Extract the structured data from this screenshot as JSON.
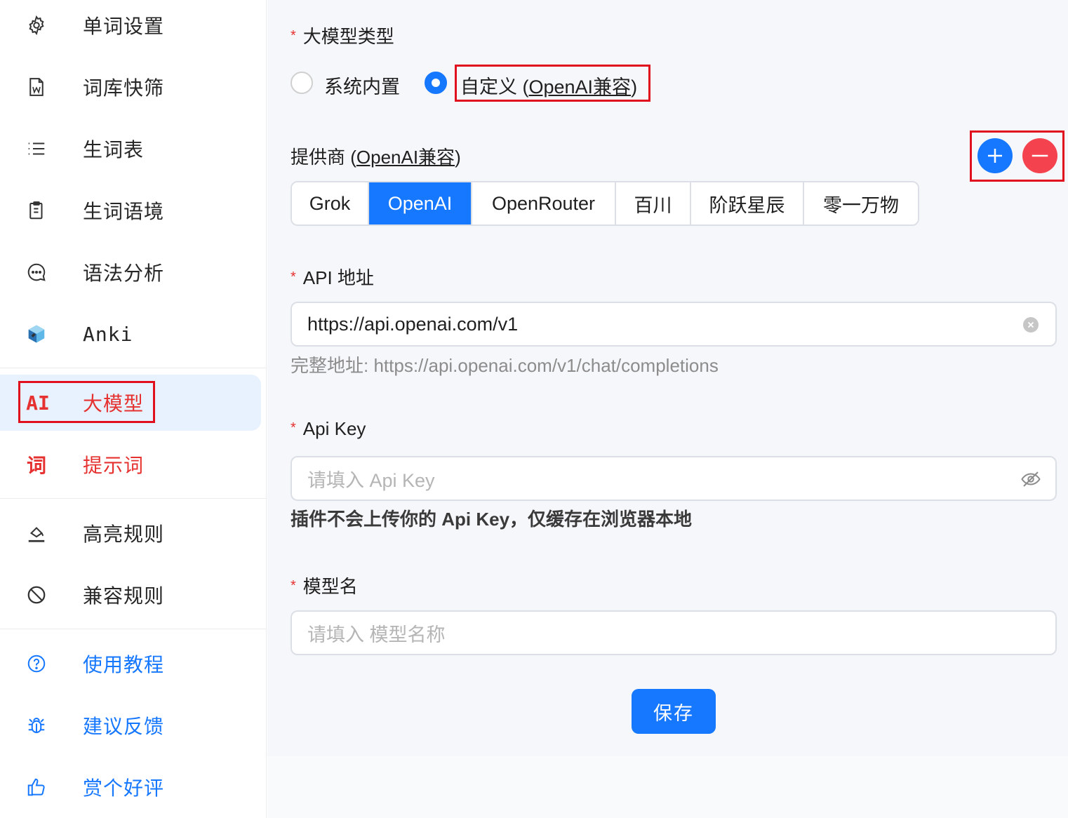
{
  "sidebar": {
    "items": [
      {
        "label": "单词设置",
        "icon": "gear-icon"
      },
      {
        "label": "词库快筛",
        "icon": "word-document-icon"
      },
      {
        "label": "生词表",
        "icon": "list-icon"
      },
      {
        "label": "生词语境",
        "icon": "clipboard-icon"
      },
      {
        "label": "语法分析",
        "icon": "chat-bubble-icon"
      },
      {
        "label": "Anki",
        "icon": "anki-logo-icon"
      },
      {
        "label": "大模型",
        "icon_text": "AI"
      },
      {
        "label": "提示词",
        "icon_text": "词"
      },
      {
        "label": "高亮规则",
        "icon": "highlighter-icon"
      },
      {
        "label": "兼容规则",
        "icon": "block-icon"
      },
      {
        "label": "使用教程",
        "icon": "help-circle-icon"
      },
      {
        "label": "建议反馈",
        "icon": "bug-icon"
      },
      {
        "label": "赏个好评",
        "icon": "thumbs-up-icon"
      }
    ]
  },
  "form": {
    "model_type": {
      "label": "大模型类型",
      "options": [
        "系统内置"
      ],
      "selected_prefix": "自定义 (",
      "selected_link": "OpenAI兼容",
      "selected_suffix": ")"
    },
    "provider": {
      "label_prefix": "提供商 (",
      "label_link": "OpenAI兼容",
      "label_suffix": ")",
      "options": [
        "Grok",
        "OpenAI",
        "OpenRouter",
        "百川",
        "阶跃星辰",
        "零一万物"
      ],
      "selected": "OpenAI"
    },
    "api_url": {
      "label": "API 地址",
      "value": "https://api.openai.com/v1",
      "hint": "完整地址: https://api.openai.com/v1/chat/completions"
    },
    "api_key": {
      "label": "Api Key",
      "placeholder": "请填入 Api Key",
      "note": "插件不会上传你的 Api Key，仅缓存在浏览器本地"
    },
    "model_name": {
      "label": "模型名",
      "placeholder": "请填入 模型名称"
    },
    "save_label": "保存"
  },
  "colors": {
    "accent": "#1677ff",
    "danger": "#f5424f",
    "highlight_box": "#e0101f",
    "active_nav_bg": "#e8f2ff"
  }
}
